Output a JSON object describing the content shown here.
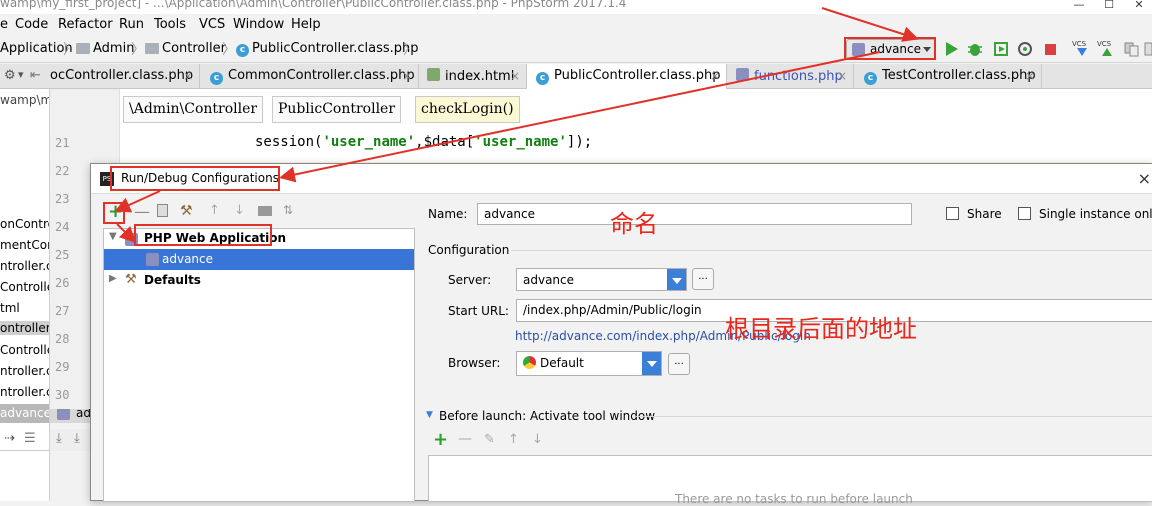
{
  "window": {
    "title": "wamp\\my_first_project] - ...\\Application\\Admin\\Controller\\PublicController.class.php - PhpStorm 2017.1.4",
    "min": "—",
    "max": "☐",
    "close": "✕"
  },
  "menu": [
    "e",
    "Code",
    "Refactor",
    "Run",
    "Tools",
    "VCS",
    "Window",
    "Help"
  ],
  "breadcrumb": {
    "items": [
      "Application",
      "Admin",
      "Controller",
      "PublicController.class.php"
    ],
    "sep": "〉"
  },
  "run_config": {
    "selected": "advance"
  },
  "toolbar": {
    "vcs1": "VCS",
    "vcs2": "VCS"
  },
  "tabs": [
    {
      "label": "ocController.class.php",
      "icon": "class-icon"
    },
    {
      "label": "CommonController.class.php",
      "icon": "class-icon"
    },
    {
      "label": "index.html",
      "icon": "html-icon"
    },
    {
      "label": "PublicController.class.php",
      "icon": "class-icon",
      "active": true
    },
    {
      "label": "functions.php",
      "icon": "php-icon"
    },
    {
      "label": "TestController.class.php",
      "icon": "class-icon"
    }
  ],
  "tab_close": "×",
  "project_panel": {
    "path": "wamp\\m",
    "items": [
      "onContro",
      "mentCon",
      "ntroller.c",
      "Controlle",
      "tml",
      "ontroller",
      "Controller",
      "ntroller.c",
      "ntroller.c"
    ],
    "run_tab": "advance",
    "run_tab2": "ad"
  },
  "editor": {
    "scope_chips": [
      "\\Admin\\Controller",
      "PublicController",
      "checkLogin()"
    ],
    "line_numbers": [
      "21",
      "22",
      "23",
      "24",
      "25",
      "26",
      "27",
      "28",
      "29",
      "30"
    ],
    "code": {
      "prefix": "session(",
      "str1": "'user_name'",
      "mid": ",$data[",
      "str2": "'user_name'",
      "suffix": "]);"
    }
  },
  "dialog": {
    "title": "Run/Debug Configurations",
    "close": "×",
    "tree": {
      "group": "PHP Web Application",
      "child": "advance",
      "defaults": "Defaults"
    },
    "name_label": "Name:",
    "name_value": "advance",
    "share_label": "Share",
    "single_instance_label": "Single instance only",
    "configuration_label": "Configuration",
    "server_label": "Server:",
    "server_value": "advance",
    "start_url_label": "Start URL:",
    "start_url_value": "/index.php/Admin/Public/login",
    "resolved_url": "http://advance.com/index.php/Admin/Public/login",
    "browser_label": "Browser:",
    "browser_value": "Default",
    "dots": "...",
    "before_launch_label": "Before launch: Activate tool window",
    "no_tasks": "There are no tasks to run before launch"
  },
  "annotations": {
    "name_note": "命名",
    "url_note": "根目录后面的地址"
  },
  "colors": {
    "annotation_red": "#e03228",
    "selection_blue": "#3875d7",
    "link_blue": "#2a4fa8",
    "string_green": "#108010"
  }
}
